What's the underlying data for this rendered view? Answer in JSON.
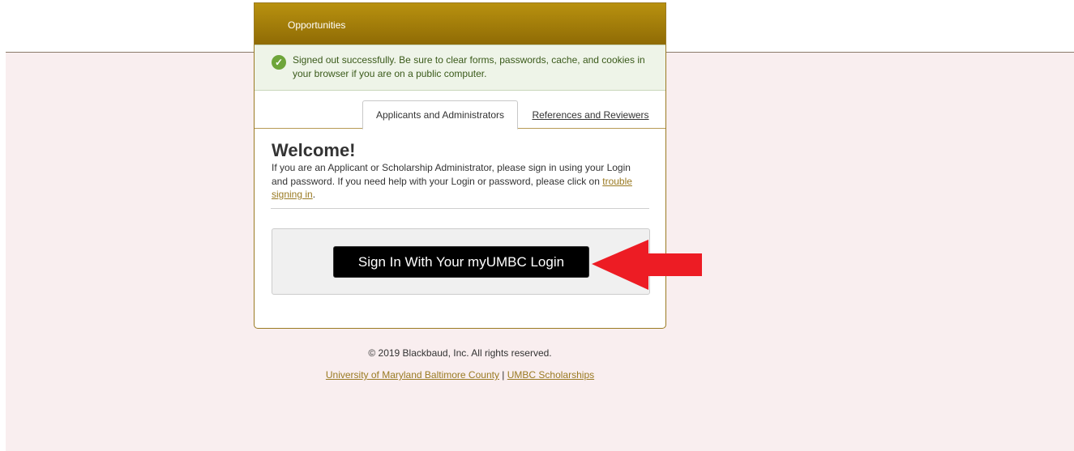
{
  "header": {
    "title": "Opportunities"
  },
  "alert": {
    "icon": "check-circle-icon",
    "message": "Signed out successfully. Be sure to clear forms, passwords, cache, and cookies in your browser if you are on a public computer."
  },
  "tabs": [
    {
      "label": "Applicants and Administrators",
      "active": true
    },
    {
      "label": "References and Reviewers",
      "active": false
    }
  ],
  "welcome": {
    "heading": "Welcome!",
    "body_prefix": "If you are an Applicant or Scholarship Administrator, please sign in using your Login and password. If you need help with your Login or password, please click on ",
    "link": "trouble signing in",
    "body_suffix": "."
  },
  "signin": {
    "button_label": "Sign In With Your myUMBC Login"
  },
  "annotation": {
    "icon": "red-arrow-icon",
    "color": "#ed1c24"
  },
  "footer": {
    "copyright": "© 2019 Blackbaud, Inc. All rights reserved.",
    "link1": "University of Maryland Baltimore County",
    "separator": " | ",
    "link2": "UMBC Scholarships"
  },
  "colors": {
    "brand": "#9a7a22",
    "background": "#f9eeef",
    "success": "#6ea53a"
  }
}
